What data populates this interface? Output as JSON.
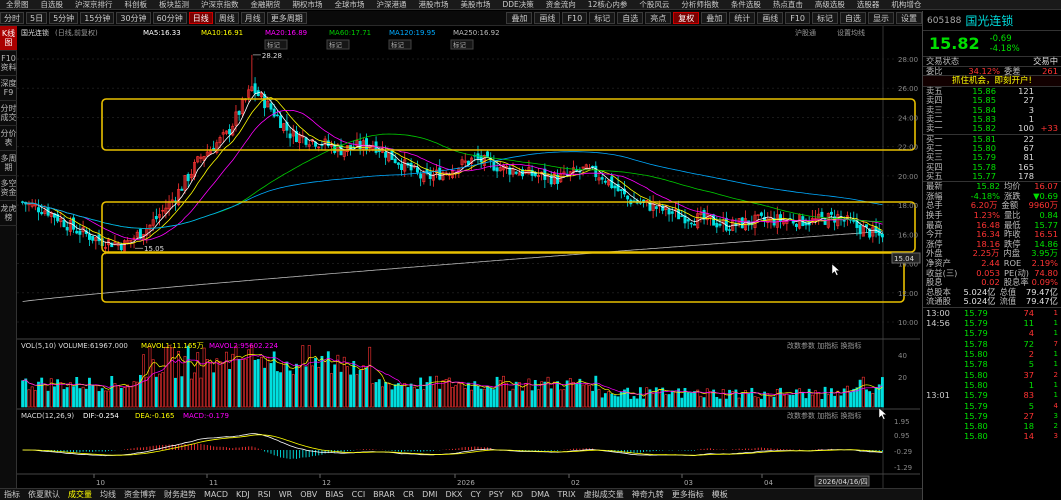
{
  "topbar": [
    "全景图",
    "自选股",
    "沪深京排行",
    "科创板",
    "板块监测",
    "沪深京指数",
    "金融期货",
    "期权市场",
    "全球市场",
    "沪深港通",
    "港股市场",
    "美股市场",
    "DDE决策",
    "资金流向",
    "12核心内参",
    "个股风云",
    "分析师指数",
    "条件选股",
    "热点直击",
    "高级选股",
    "选股器",
    "机构增仓"
  ],
  "periods": [
    "分时",
    "5日",
    "5分钟",
    "15分钟",
    "30分钟",
    "60分钟",
    "日线",
    "周线",
    "月线",
    "更多周期"
  ],
  "period_active": "日线",
  "right_buttons": [
    "叠加",
    "画线",
    "F10",
    "标记",
    "自选",
    "亮点",
    "复权",
    "叠加",
    "统计",
    "画线",
    "F10",
    "标记",
    "自选",
    "显示",
    "设置"
  ],
  "right_active": "复权",
  "sidebar": [
    "K线图",
    "F10资料",
    "深度F9",
    "分时成交",
    "分价表",
    "多周期",
    "多空资金",
    "龙虎榜"
  ],
  "sidebar_active": "K线图",
  "legend": {
    "stock": "国光连锁",
    "mode": "(日线,前复权)",
    "ma5": "MA5:16.33",
    "ma10": "MA10:16.91",
    "ma20": "MA20:16.89",
    "ma60": "MA60:17.71",
    "ma120": "MA120:19.95",
    "ma250": "MA250:16.92",
    "hgt": "沪股通",
    "settings": "设置均线",
    "hi_label": "28.28",
    "lo_label": "15.05",
    "vol": "VOL(5,10) VOLUME:61967.000",
    "mavol1": "MAVOL1:11.165万",
    "mavol2": "MAVOL2:95602.224",
    "vol_tools": "改数参数  加指标  换指标",
    "macd": "MACD(12,26,9)",
    "dif": "DIF:-0.254",
    "dea": "DEA:-0.165",
    "macdv": "MACD:-0.179",
    "macd_tools": "改数参数  加指标  换指标",
    "marks": [
      "标记",
      "标记",
      "标记",
      "标记"
    ]
  },
  "price_axis": [
    "28.00",
    "26.00",
    "24.00",
    "22.00",
    "20.00",
    "18.00",
    "16.00",
    "14.00",
    "12.00",
    "10.00"
  ],
  "axis_tag": "15.04",
  "vol_axis": [
    "40",
    "20"
  ],
  "macd_axis": [
    "1.95",
    "0.95",
    "-0.29",
    "-1.29"
  ],
  "date_axis": [
    "10",
    "11",
    "12",
    "2026",
    "02",
    "03",
    "04"
  ],
  "date_tag": "2026/04/16/四",
  "bottombar": [
    "指标",
    "依夏默认",
    "成交量",
    "均线",
    "资金博弈",
    "财务趋势",
    "MACD",
    "KDJ",
    "RSI",
    "WR",
    "OBV",
    "BIAS",
    "CCI",
    "BRAR",
    "CR",
    "DMI",
    "DKX",
    "CY",
    "PSY",
    "KD",
    "DMA",
    "TRIX",
    "虚拟成交量",
    "神奇九转",
    "更多指标",
    "模板"
  ],
  "bottom_active": "成交量",
  "panel": {
    "code": "605188",
    "name": "国光连锁",
    "price": "15.82",
    "chg": "-0.69",
    "pct": "-4.18%",
    "status_l": "交易状态",
    "status_r": "交易中",
    "wb_l": "委比",
    "wb_v": "34.12%",
    "wc_l": "委差",
    "wc_v": "261",
    "chance": "抓住机会，即刻开户!",
    "asks": [
      [
        "卖五",
        "15.86",
        "121",
        ""
      ],
      [
        "卖四",
        "15.85",
        "27",
        ""
      ],
      [
        "卖三",
        "15.84",
        "3",
        ""
      ],
      [
        "卖二",
        "15.83",
        "1",
        ""
      ],
      [
        "卖一",
        "15.82",
        "100",
        "+33"
      ]
    ],
    "bids": [
      [
        "买一",
        "15.81",
        "22",
        ""
      ],
      [
        "买二",
        "15.80",
        "67",
        ""
      ],
      [
        "买三",
        "15.79",
        "81",
        ""
      ],
      [
        "买四",
        "15.78",
        "165",
        ""
      ],
      [
        "买五",
        "15.77",
        "178",
        ""
      ]
    ],
    "stats": [
      [
        "最新",
        "15.82",
        "均价",
        "16.07"
      ],
      [
        "涨幅",
        "-4.18%",
        "涨跌",
        "▼0.69"
      ],
      [
        "总手",
        "6.20万",
        "金额",
        "9960万"
      ],
      [
        "换手",
        "1.23%",
        "量比",
        "0.84"
      ],
      [
        "最高",
        "16.48",
        "最低",
        "15.77"
      ],
      [
        "今开",
        "16.34",
        "昨收",
        "16.51"
      ],
      [
        "涨停",
        "18.16",
        "跌停",
        "14.86"
      ],
      [
        "外盘",
        "2.25万",
        "内盘",
        "3.95万"
      ],
      [
        "净资产",
        "2.44",
        "ROE",
        "2.19%"
      ],
      [
        "收益(三)",
        "0.053",
        "PE(动)",
        "74.80"
      ],
      [
        "股息",
        "0.02",
        "股息率",
        "0.09%"
      ],
      [
        "总股本",
        "5.024亿",
        "总值",
        "79.47亿"
      ],
      [
        "流通股",
        "5.024亿",
        "流值",
        "79.47亿"
      ]
    ],
    "ticks": [
      [
        "13:00",
        "15.79",
        "74",
        "1"
      ],
      [
        "14:56",
        "15.79",
        "11",
        "1"
      ],
      [
        "",
        "15.79",
        "4",
        "1"
      ],
      [
        "",
        "15.78",
        "72",
        "7"
      ],
      [
        "",
        "15.80",
        "2",
        "1"
      ],
      [
        "",
        "15.78",
        "5",
        "1"
      ],
      [
        "",
        "15.80",
        "37",
        "2"
      ],
      [
        "",
        "15.80",
        "1",
        "1"
      ],
      [
        "13:01",
        "15.79",
        "83",
        "1"
      ],
      [
        "",
        "15.79",
        "5",
        "4"
      ],
      [
        "",
        "15.79",
        "27",
        "3"
      ],
      [
        "",
        "15.80",
        "18",
        "2"
      ],
      [
        "",
        "15.80",
        "14",
        "3"
      ]
    ]
  }
}
